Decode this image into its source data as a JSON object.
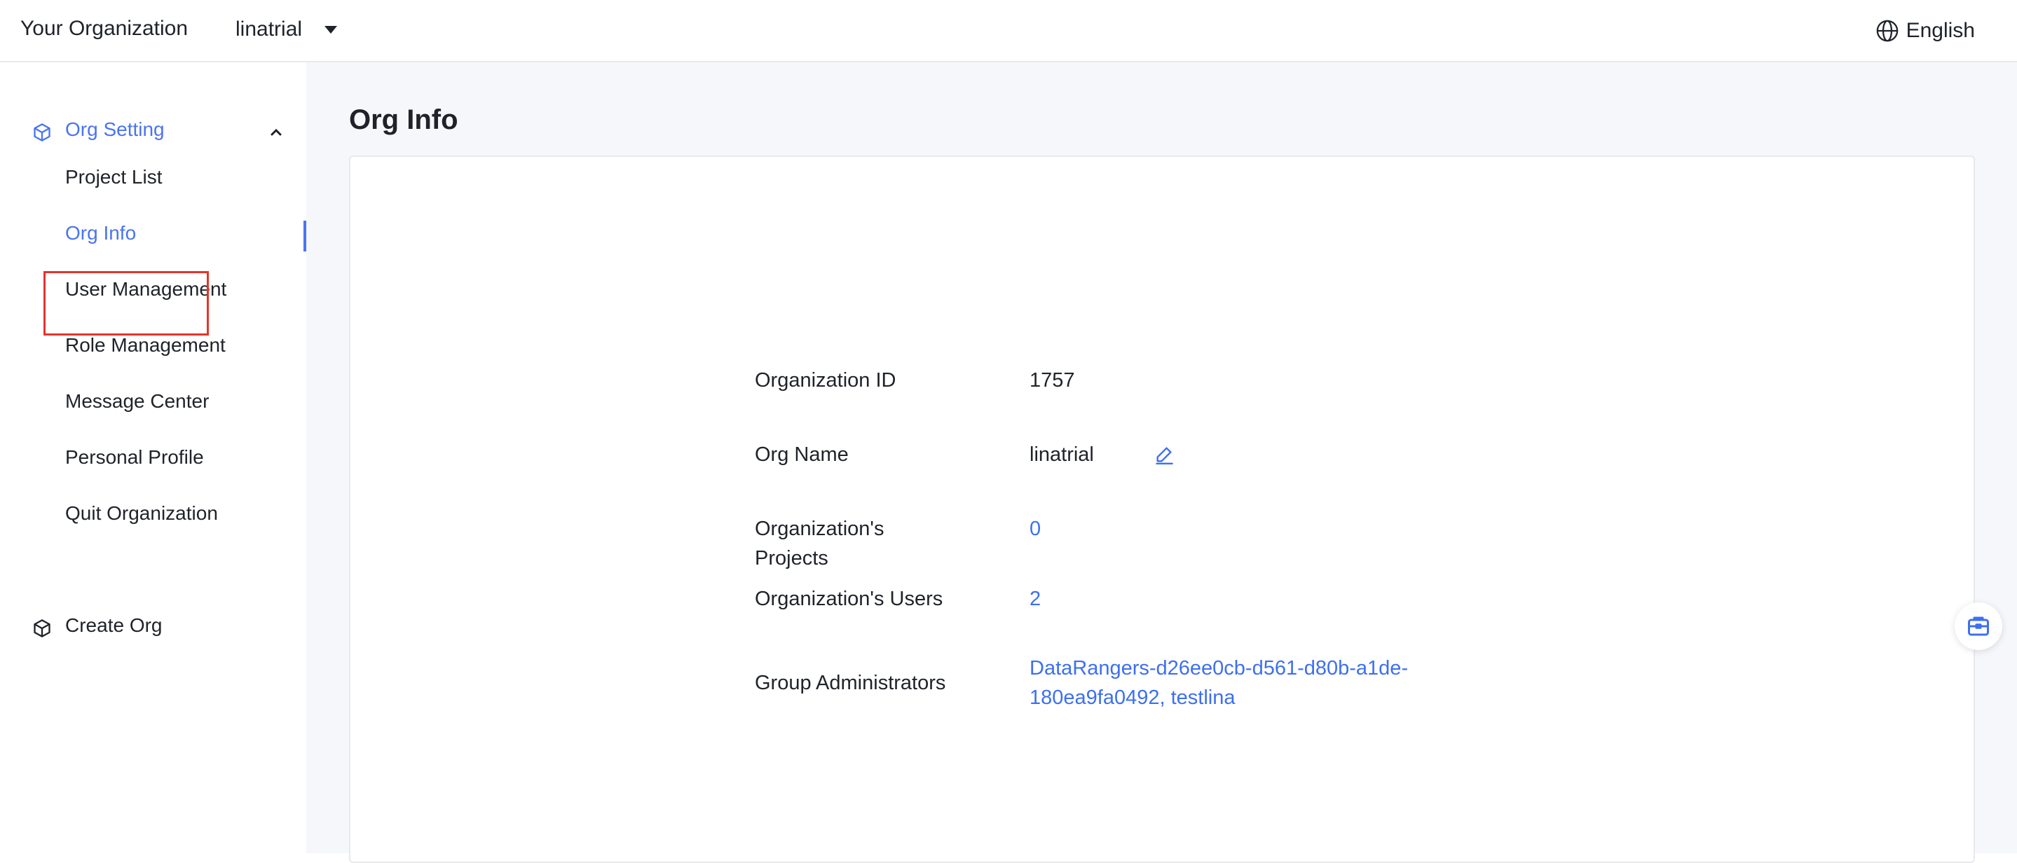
{
  "header": {
    "org_title": "Your Organization",
    "org_selector": "linatrial",
    "language": "English"
  },
  "sidebar": {
    "group": {
      "label": "Org Setting",
      "icon": "cube-icon",
      "expanded": true
    },
    "items": [
      {
        "label": "Project List"
      },
      {
        "label": "Org Info",
        "active": true
      },
      {
        "label": "User Management"
      },
      {
        "label": "Role Management"
      },
      {
        "label": "Message Center"
      },
      {
        "label": "Personal Profile"
      },
      {
        "label": "Quit Organization"
      }
    ],
    "create_org": {
      "label": "Create Org",
      "icon": "cube-icon"
    }
  },
  "main": {
    "page_title": "Org Info",
    "info": {
      "org_id": {
        "label": "Organization ID",
        "value": "1757"
      },
      "org_name": {
        "label": "Org Name",
        "value": "linatrial"
      },
      "projects": {
        "label_line1": "Organization's",
        "label_line2": "Projects",
        "value": "0"
      },
      "users": {
        "label": "Organization's Users",
        "value": "2"
      },
      "admins": {
        "label": "Group Administrators",
        "value_line1": "DataRangers-d26ee0cb-d561-d80b-a1de-",
        "value_line2": "180ea9fa0492,  testlina"
      }
    }
  },
  "colors": {
    "accent": "#4a74f0",
    "link": "#3d6ff0",
    "highlight": "#e5342b",
    "main_bg": "#f6f7fb"
  }
}
